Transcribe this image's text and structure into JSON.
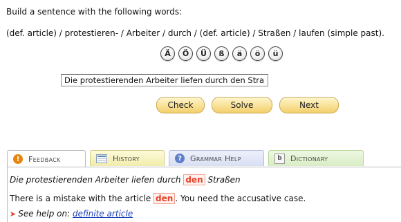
{
  "instruction": "Build a sentence with the following words:",
  "words": "(def. article) / protestieren- / Arbeiter / durch / (def. article) / Straßen / laufen (simple past).",
  "special_chars": [
    "Ä",
    "Ö",
    "Ü",
    "ß",
    "ä",
    "ö",
    "ü"
  ],
  "answer": {
    "value": "Die protestierenden Arbeiter liefen durch den Straßen."
  },
  "actions": {
    "check": "Check",
    "solve": "Solve",
    "next": "Next"
  },
  "tabs": {
    "feedback": "Feedback",
    "history": "History",
    "grammar_help": "Grammar Help",
    "dictionary": "Dictionary"
  },
  "tab_icons": {
    "feedback": "exclamation-icon",
    "history": "history-icon",
    "grammar_help": "question-icon",
    "dictionary": "dictionary-icon"
  },
  "feedback": {
    "sentence_before": "Die protestierenden Arbeiter liefen durch ",
    "sentence_error": "den",
    "sentence_after": " Straßen",
    "message_before": "There is a mistake with the article ",
    "message_error": "den",
    "message_after": ". You need the accusative case.",
    "help_prefix": "See help on: ",
    "help_link": "definite article"
  },
  "colors": {
    "error": "#e8412b",
    "button": "#f3cf6c",
    "link": "#1a3fb8"
  }
}
